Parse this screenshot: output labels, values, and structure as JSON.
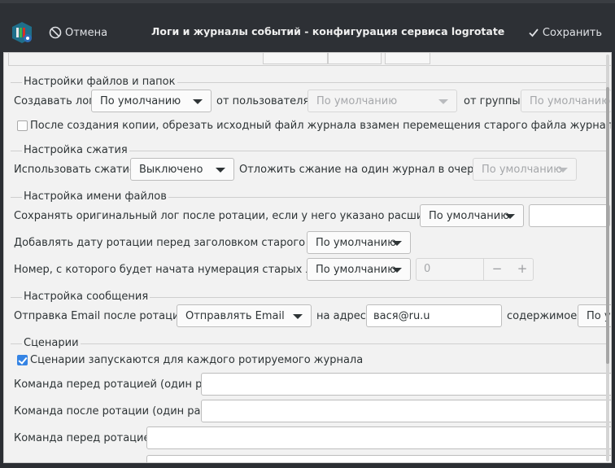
{
  "window": {
    "title": "Логи и журналы событий - конфигурация сервиса logrotate",
    "cancel_label": "Отмена",
    "save_label": "Сохранить"
  },
  "files": {
    "legend": "Настройки файлов и папок",
    "create_log_label": "Создавать лог",
    "create_log_value": "По умолчанию",
    "from_user_label": "от пользователя:",
    "from_user_value": "По умолчанию",
    "from_group_label": "от группы:",
    "from_group_value": "По умолчанию",
    "copytruncate_label": "После создания копии, обрезать исходный файл журнала взамен перемещения старого файла журнала и создан"
  },
  "compression": {
    "legend": "Настройка сжатия",
    "use_label": "Использовать сжатие:",
    "use_value": "Выключено",
    "delay_label": "Отложить сжание на один журнал в очереди:",
    "delay_value": "По умолчанию"
  },
  "filename": {
    "legend": "Настройка имени файлов",
    "extension_label": "Сохранять оригинальный лог после ротации, если у него указано расширение:",
    "extension_value": "По умолчанию",
    "dateext_label": "Добавлять дату ротации перед заголовком старого лога:",
    "dateext_value": "По умолчанию",
    "start_label": "Номер, с которого будет начата нумерация старых логов:",
    "start_value": "По умолчанию",
    "start_number": "0",
    "minus": "−",
    "plus": "+"
  },
  "message": {
    "legend": "Настройка сообщения",
    "email_label": "Отправка Email после ротации:",
    "email_value": "Отправлять Email",
    "address_label": "на адрес:",
    "address_value": "вася@ru.u",
    "content_label": "содержимое:",
    "content_value": "По у"
  },
  "scripts": {
    "legend": "Сценарии",
    "sharedscripts_label": "Сценарии запускаются для каждого ротируемого журнала",
    "sharedscripts_checked": true,
    "firstaction_label": "Команда перед ротацией (один раз):",
    "lastaction_label": "Команда после ротации (один раз):",
    "prerotate_label": "Команда перед ротацией:"
  },
  "colors": {
    "header_bg": "#2d3035",
    "panel_bg": "#f2f2f2",
    "accent": "#3584e4"
  }
}
